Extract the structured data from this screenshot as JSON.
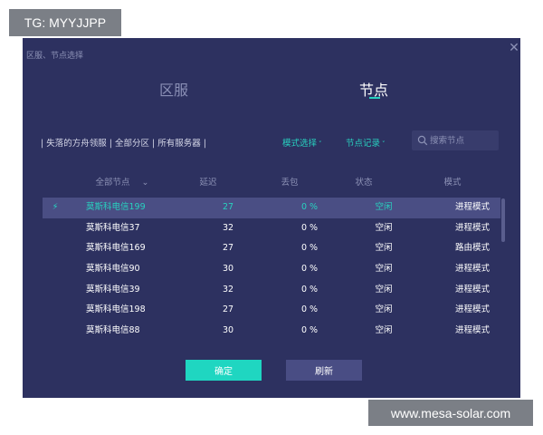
{
  "watermark_tg": "TG: MYYJJPP",
  "watermark_site": "www.mesa-solar.com",
  "dialog": {
    "title": "区服、节点选择",
    "close_icon": "close-icon"
  },
  "tabs": [
    {
      "label": "区服",
      "active": false
    },
    {
      "label": "节点",
      "active": true
    }
  ],
  "filter": {
    "text": "| 失落的方舟领服 | 全部分区 | 所有服务器 |",
    "mode_dropdown": "模式选择",
    "record_dropdown": "节点记录",
    "caret": "˅",
    "search_placeholder": "搜索节点",
    "search_value": ""
  },
  "table": {
    "headers": {
      "nodes": "全部节点",
      "nodes_caret": "⌄",
      "latency": "延迟",
      "loss": "丢包",
      "status": "状态",
      "mode": "模式"
    },
    "rows": [
      {
        "name": "莫斯科电信199",
        "latency": "27",
        "loss": "0 %",
        "status": "空闲",
        "mode": "进程模式",
        "icon": "⚡"
      },
      {
        "name": "莫斯科电信37",
        "latency": "32",
        "loss": "0 %",
        "status": "空闲",
        "mode": "进程模式",
        "icon": ""
      },
      {
        "name": "莫斯科电信169",
        "latency": "27",
        "loss": "0 %",
        "status": "空闲",
        "mode": "路由模式",
        "icon": ""
      },
      {
        "name": "莫斯科电信90",
        "latency": "30",
        "loss": "0 %",
        "status": "空闲",
        "mode": "进程模式",
        "icon": ""
      },
      {
        "name": "莫斯科电信39",
        "latency": "32",
        "loss": "0 %",
        "status": "空闲",
        "mode": "进程模式",
        "icon": ""
      },
      {
        "name": "莫斯科电信198",
        "latency": "27",
        "loss": "0 %",
        "status": "空闲",
        "mode": "进程模式",
        "icon": ""
      },
      {
        "name": "莫斯科电信88",
        "latency": "30",
        "loss": "0 %",
        "status": "空闲",
        "mode": "进程模式",
        "icon": ""
      }
    ],
    "selected_row": 0
  },
  "buttons": {
    "confirm": "确定",
    "refresh": "刷新"
  },
  "colors": {
    "background": "#2d3160",
    "accent": "#28d1bf",
    "selected_row": "#4a4e84",
    "muted_text": "#8c91b5"
  }
}
